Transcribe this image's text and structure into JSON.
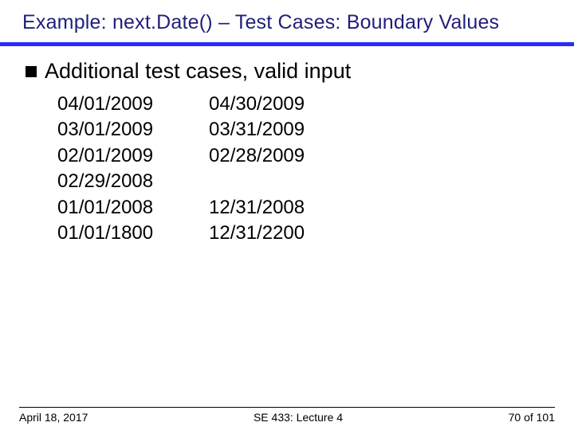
{
  "title": "Example: next.Date() – Test Cases: Boundary Values",
  "bullet": "Additional test cases, valid input",
  "columns": {
    "left": [
      "04/01/2009",
      "03/01/2009",
      "02/01/2009",
      "02/29/2008",
      "01/01/2008",
      "01/01/1800"
    ],
    "right": [
      "04/30/2009",
      "03/31/2009",
      "02/28/2009",
      "",
      "12/31/2008",
      "12/31/2200"
    ]
  },
  "footer": {
    "date": "April 18, 2017",
    "center": "SE 433: Lecture 4",
    "page": "70 of 101"
  }
}
